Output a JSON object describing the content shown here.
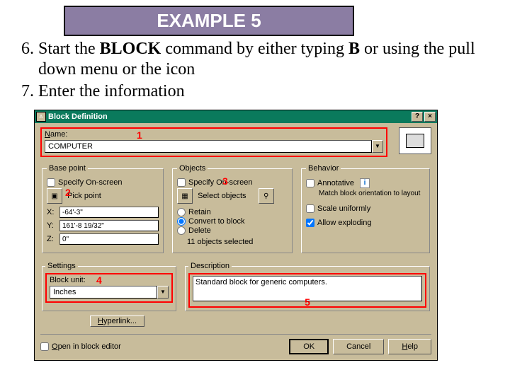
{
  "banner": "EXAMPLE 5",
  "instructions": {
    "item6_prefix": "Start the ",
    "item6_cmd": "BLOCK",
    "item6_mid": " command by either typing ",
    "item6_b": "B",
    "item6_suffix": " or using the pull down menu or the icon",
    "item7": "Enter the information"
  },
  "dialog": {
    "title": "Block Definition",
    "name_label": "Name:",
    "name_value": "COMPUTER",
    "basepoint": {
      "legend": "Base point",
      "specify": "Specify On-screen",
      "pick": "Pick point",
      "x_label": "X:",
      "x": "-64'-3\"",
      "y_label": "Y:",
      "y": "161'-8 19/32\"",
      "z_label": "Z:",
      "z": "0\""
    },
    "objects": {
      "legend": "Objects",
      "specify": "Specify On-screen",
      "select": "Select objects",
      "retain": "Retain",
      "convert": "Convert to block",
      "delete": "Delete",
      "count": "11 objects selected"
    },
    "behavior": {
      "legend": "Behavior",
      "annotative": "Annotative",
      "match": "Match block orientation to layout",
      "scale": "Scale uniformly",
      "explode": "Allow exploding"
    },
    "settings": {
      "legend": "Settings",
      "unit_label": "Block unit:",
      "unit_value": "Inches"
    },
    "description": {
      "legend": "Description",
      "value": "Standard block for generic computers."
    },
    "hyperlink": "Hyperlink...",
    "open_editor": "Open in block editor",
    "ok": "OK",
    "cancel": "Cancel",
    "help": "Help"
  },
  "marks": {
    "m1": "1",
    "m2": "2",
    "m3": "3",
    "m4": "4",
    "m5": "5"
  }
}
